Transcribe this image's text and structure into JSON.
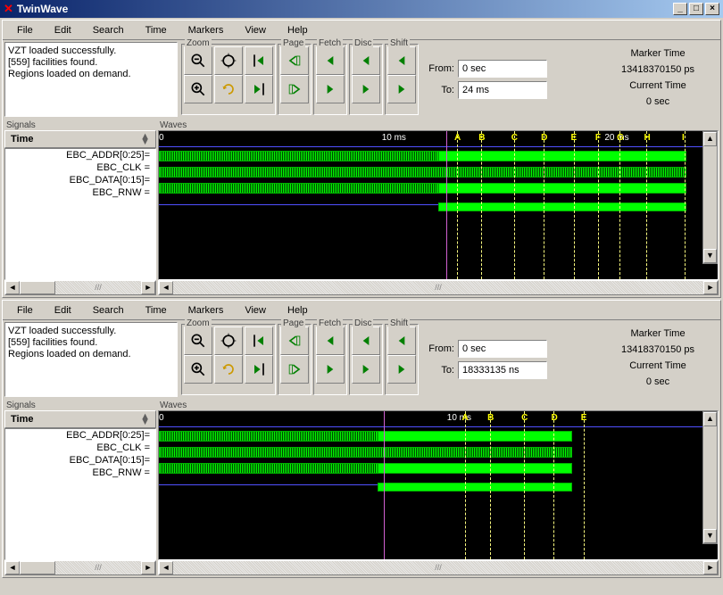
{
  "window": {
    "title": "TwinWave"
  },
  "menu": [
    "File",
    "Edit",
    "Search",
    "Time",
    "Markers",
    "View",
    "Help"
  ],
  "status": {
    "line1": "VZT loaded successfully.",
    "line2": "[559] facilities found.",
    "line3": "Regions loaded on demand."
  },
  "toolGroups": {
    "zoom": "Zoom",
    "page": "Page",
    "fetch": "Fetch",
    "disc": "Disc",
    "shift": "Shift"
  },
  "timeRange": [
    {
      "fromLabel": "From:",
      "from": "0 sec",
      "toLabel": "To:",
      "to": "24 ms"
    },
    {
      "fromLabel": "From:",
      "from": "0 sec",
      "toLabel": "To:",
      "to": "18333135 ns"
    }
  ],
  "markerInfo": {
    "markerLabel": "Marker Time",
    "markerValue": "13418370150 ps",
    "currentLabel": "Current Time",
    "currentValue": "0 sec"
  },
  "signalsLabel": "Signals",
  "wavesLabel": "Waves",
  "timeHeader": "Time",
  "signals": [
    "EBC_ADDR[0:25]=",
    "EBC_CLK =",
    "EBC_DATA[0:15]=",
    "EBC_RNW ="
  ],
  "timeTicks": [
    [
      {
        "label": "0",
        "pct": 0
      },
      {
        "label": "10 ms",
        "pct": 41
      },
      {
        "label": "20 ms",
        "pct": 82
      }
    ],
    [
      {
        "label": "0",
        "pct": 0
      },
      {
        "label": "10 ms",
        "pct": 53
      }
    ]
  ],
  "markerSets": [
    [
      {
        "l": "A",
        "p": 55
      },
      {
        "l": "B",
        "p": 59.5
      },
      {
        "l": "C",
        "p": 65.5
      },
      {
        "l": "D",
        "p": 71
      },
      {
        "l": "E",
        "p": 76.5
      },
      {
        "l": "F",
        "p": 81
      },
      {
        "l": "G",
        "p": 85
      },
      {
        "l": "H",
        "p": 90
      },
      {
        "l": "I",
        "p": 97
      }
    ],
    [
      {
        "l": "A",
        "p": 72
      },
      {
        "l": "B",
        "p": 78
      },
      {
        "l": "C",
        "p": 86
      },
      {
        "l": "D",
        "p": 93
      },
      {
        "l": "E",
        "p": 100
      }
    ]
  ]
}
